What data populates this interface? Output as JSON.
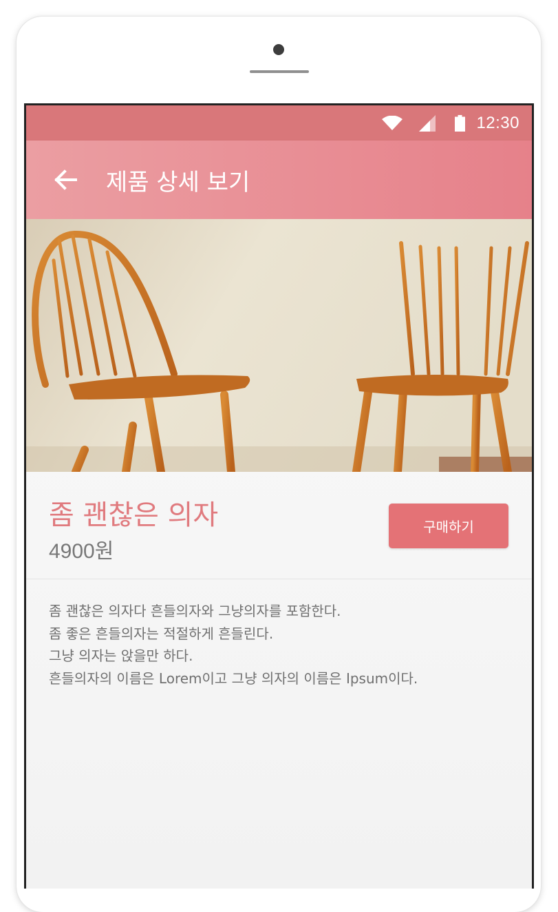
{
  "status_bar": {
    "time": "12:30",
    "icons": [
      "wifi-icon",
      "signal-icon",
      "battery-icon"
    ]
  },
  "app_bar": {
    "back_icon": "back-arrow-icon",
    "title": "제품 상세 보기"
  },
  "product": {
    "image": "two-wooden-chairs-photo",
    "name": "좀 괜찮은 의자",
    "price": "4900원",
    "buy_label": "구매하기",
    "description": [
      "좀 괜찮은 의자다 흔들의자와 그냥의자를 포함한다.",
      "좀 좋은 흔들의자는 적절하게 흔들린다.",
      "그냥 의자는 앉을만 하다.",
      "흔들의자의 이름은 Lorem이고 그냥 의자의 이름은 Ipsum이다."
    ]
  },
  "colors": {
    "status_bar": "#d9777a",
    "app_bar_start": "#eb9ea2",
    "app_bar_end": "#e6818a",
    "accent": "#e07a7e",
    "button": "#e47276",
    "body_text": "#6f6f6f"
  }
}
